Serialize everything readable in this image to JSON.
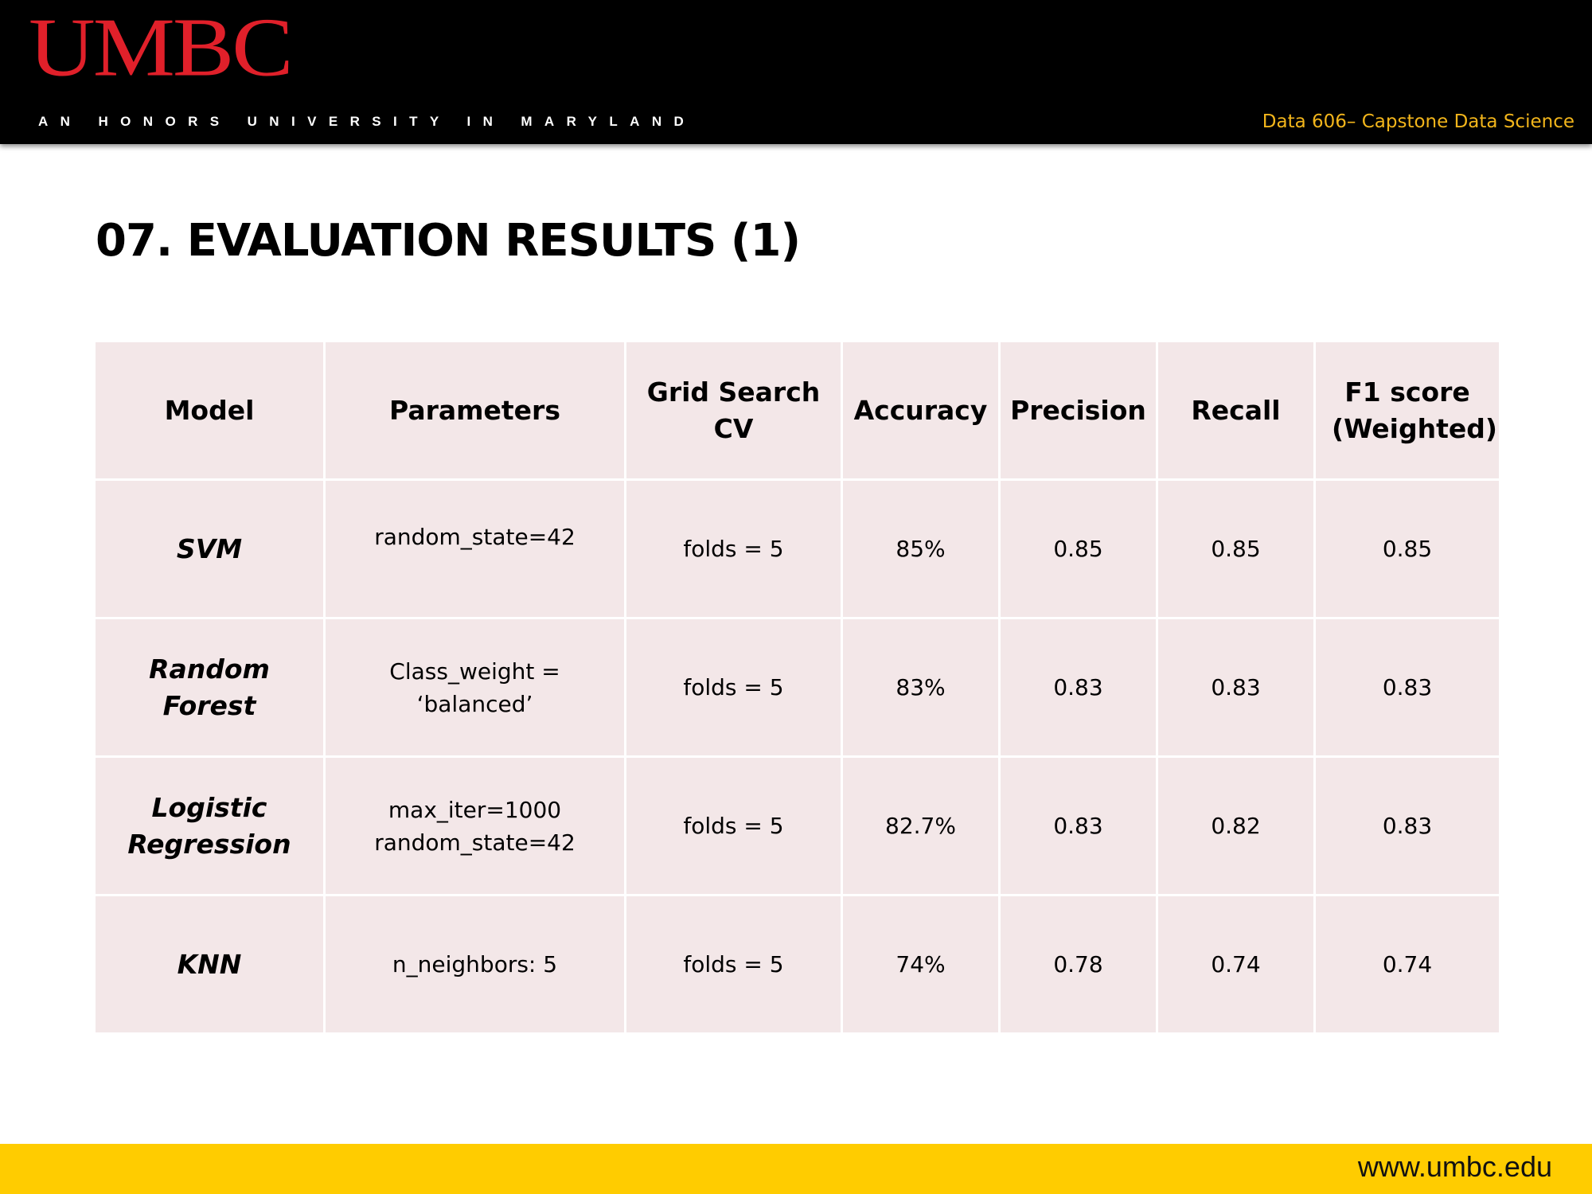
{
  "header": {
    "logo": "UMBC",
    "tagline": "AN HONORS UNIVERSITY IN MARYLAND",
    "course": "Data 606– Capstone Data Science"
  },
  "slide": {
    "title": "07. EVALUATION RESULTS (1)"
  },
  "table": {
    "headers": [
      "Model",
      "Parameters",
      "Grid Search CV",
      "Accuracy",
      "Precision",
      "Recall",
      "F1 score (Weighted)"
    ],
    "rows": [
      {
        "model": "SVM",
        "params": [
          "random_state=42"
        ],
        "grid": "folds = 5",
        "accuracy": "85%",
        "precision": "0.85",
        "recall": "0.85",
        "f1": "0.85"
      },
      {
        "model": "Random Forest",
        "params": [
          "Class_weight = ‘balanced’"
        ],
        "grid": "folds = 5",
        "accuracy": "83%",
        "precision": "0.83",
        "recall": "0.83",
        "f1": "0.83"
      },
      {
        "model": "Logistic Regression",
        "params": [
          "max_iter=1000",
          "random_state=42"
        ],
        "grid": "folds = 5",
        "accuracy": "82.7%",
        "precision": "0.83",
        "recall": "0.82",
        "f1": "0.83"
      },
      {
        "model": "KNN",
        "params": [
          "n_neighbors: 5"
        ],
        "grid": "folds = 5",
        "accuracy": "74%",
        "precision": "0.78",
        "recall": "0.74",
        "f1": "0.74"
      }
    ]
  },
  "footer": {
    "url": "www.umbc.edu"
  },
  "colors": {
    "brand_red": "#e0202a",
    "brand_gold": "#f2b51b",
    "footer_yellow": "#ffcc00",
    "cell_background": "#f3e7e8"
  }
}
